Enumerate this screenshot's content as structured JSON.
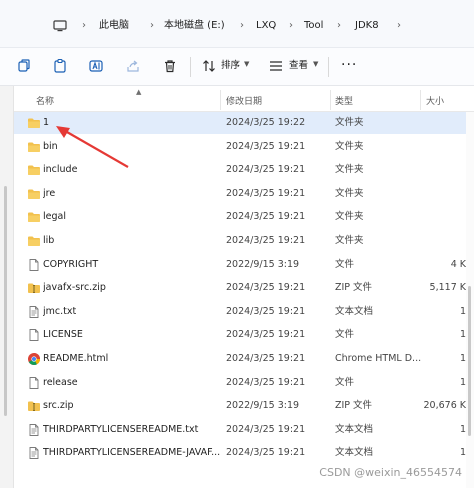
{
  "breadcrumb": {
    "items": [
      "此电脑",
      "本地磁盘 (E:)",
      "LXQ",
      "Tool",
      "JDK8"
    ],
    "separator": "›"
  },
  "toolbar": {
    "sort_label": "排序",
    "view_label": "查看",
    "more_label": "···"
  },
  "columns": {
    "name": "名称",
    "date": "修改日期",
    "type": "类型",
    "size": "大小"
  },
  "files": [
    {
      "name": "1",
      "date": "2024/3/25 19:22",
      "type": "文件夹",
      "size": "",
      "icon": "folder-icon",
      "selected": true
    },
    {
      "name": "bin",
      "date": "2024/3/25 19:21",
      "type": "文件夹",
      "size": "",
      "icon": "folder-icon"
    },
    {
      "name": "include",
      "date": "2024/3/25 19:21",
      "type": "文件夹",
      "size": "",
      "icon": "folder-icon"
    },
    {
      "name": "jre",
      "date": "2024/3/25 19:21",
      "type": "文件夹",
      "size": "",
      "icon": "folder-icon"
    },
    {
      "name": "legal",
      "date": "2024/3/25 19:21",
      "type": "文件夹",
      "size": "",
      "icon": "folder-icon"
    },
    {
      "name": "lib",
      "date": "2024/3/25 19:21",
      "type": "文件夹",
      "size": "",
      "icon": "folder-icon"
    },
    {
      "name": "COPYRIGHT",
      "date": "2022/9/15 3:19",
      "type": "文件",
      "size": "4 K",
      "icon": "document-icon"
    },
    {
      "name": "javafx-src.zip",
      "date": "2024/3/25 19:21",
      "type": "ZIP 文件",
      "size": "5,117 K",
      "icon": "zip-folder-icon"
    },
    {
      "name": "jmc.txt",
      "date": "2024/3/25 19:21",
      "type": "文本文档",
      "size": "1",
      "icon": "text-document-icon"
    },
    {
      "name": "LICENSE",
      "date": "2024/3/25 19:21",
      "type": "文件",
      "size": "1",
      "icon": "document-icon"
    },
    {
      "name": "README.html",
      "date": "2024/3/25 19:21",
      "type": "Chrome HTML D...",
      "size": "1",
      "icon": "chrome-icon"
    },
    {
      "name": "release",
      "date": "2024/3/25 19:21",
      "type": "文件",
      "size": "1",
      "icon": "document-icon"
    },
    {
      "name": "src.zip",
      "date": "2022/9/15 3:19",
      "type": "ZIP 文件",
      "size": "20,676 K",
      "icon": "zip-folder-icon"
    },
    {
      "name": "THIRDPARTYLICENSEREADME.txt",
      "date": "2024/3/25 19:21",
      "type": "文本文档",
      "size": "1",
      "icon": "text-document-icon"
    },
    {
      "name": "THIRDPARTYLICENSEREADME-JAVAF...",
      "date": "2024/3/25 19:21",
      "type": "文本文档",
      "size": "1",
      "icon": "text-document-icon"
    }
  ],
  "watermark": "CSDN @weixin_46554574",
  "colors": {
    "folder": "#f2c14e",
    "selection": "#e1ecfb",
    "annotation_arrow": "#e53935"
  }
}
